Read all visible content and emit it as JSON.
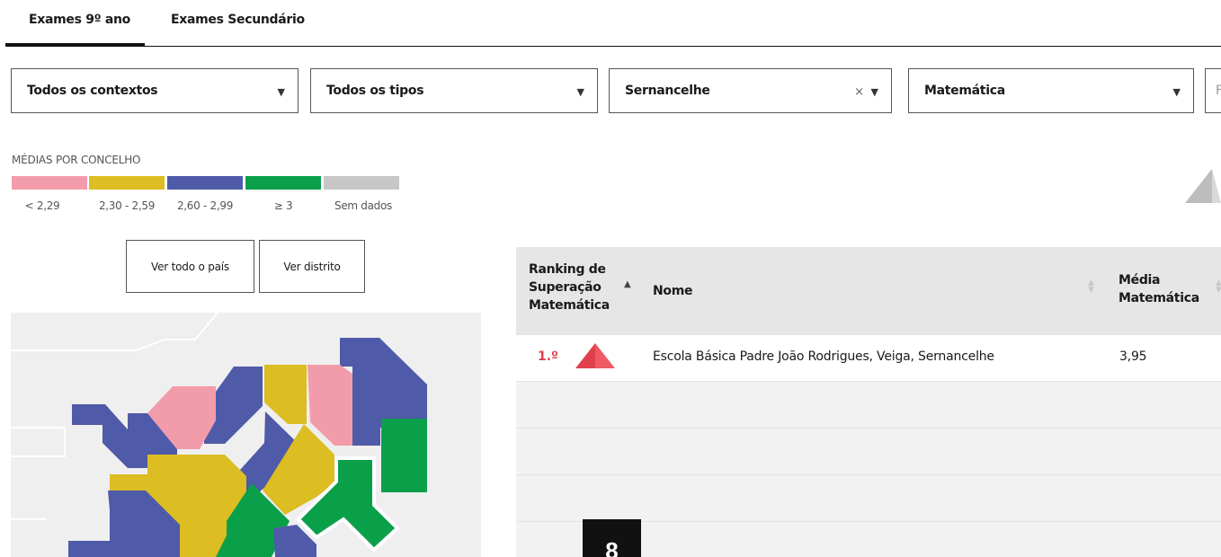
{
  "tabs": [
    {
      "label": "Exames 9º ano",
      "active": true
    },
    {
      "label": "Exames Secundário",
      "active": false
    }
  ],
  "filters": {
    "context": {
      "value": "Todos os contextos"
    },
    "type": {
      "value": "Todos os tipos"
    },
    "municipality": {
      "value": "Sernancelhe",
      "clear": "×"
    },
    "subject": {
      "value": "Matemática"
    },
    "extra": {
      "value": "F"
    },
    "arrow_glyph": "▼"
  },
  "legend": {
    "title": "MÉDIAS POR CONCELHO",
    "items": [
      {
        "label": "< 2,29",
        "color": "#f29cab"
      },
      {
        "label": "2,30 - 2,59",
        "color": "#dcbd22"
      },
      {
        "label": "2,60 - 2,99",
        "color": "#4f5aa8"
      },
      {
        "label": "≥ 3",
        "color": "#0aa04a"
      },
      {
        "label": "Sem dados",
        "color": "#c7c7c7"
      }
    ]
  },
  "buttons": {
    "country": "Ver todo o país",
    "district": "Ver distrito"
  },
  "table": {
    "headers": {
      "rank": "Ranking de Superação Matemática",
      "name": "Nome",
      "average": "Média Matemática"
    },
    "sort_up": "▲",
    "sort_both": "▲▼",
    "rows": [
      {
        "rank": "1.º",
        "name": "Escola Básica Padre João Rodrigues, Veiga, Sernancelhe",
        "average": "3,95"
      }
    ]
  },
  "page_badge": "8",
  "colors": {
    "pink": "#f29cab",
    "yellow": "#dcbd22",
    "blue": "#4f5aa8",
    "green": "#0aa04a",
    "gray": "#c7c7c7",
    "rank_red": "#e0404c"
  }
}
